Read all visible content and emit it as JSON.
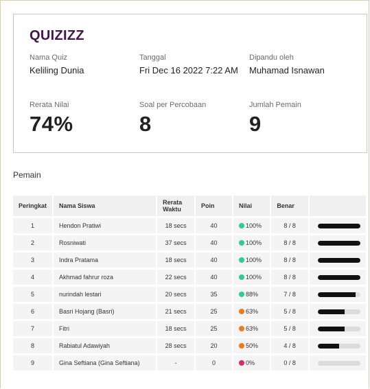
{
  "brand": {
    "logo_text": "QUIZIZZ",
    "logo_color": "#46134f"
  },
  "summary": {
    "quiz_name_label": "Nama Quiz",
    "quiz_name": "Keliling Dunia",
    "date_label": "Tanggal",
    "date": "Fri Dec 16 2022 7:22 AM",
    "host_label": "Dipandu oleh",
    "host": "Muhamad Isnawan",
    "avg_score_label": "Rerata Nilai",
    "avg_score": "74%",
    "questions_label": "Soal per Percobaan",
    "questions": "8",
    "players_label": "Jumlah Pemain",
    "players": "9"
  },
  "players_section": {
    "title": "Pemain",
    "headers": {
      "rank": "Peringkat",
      "name": "Nama Siswa",
      "avg_time": "Rerata Waktu",
      "points": "Poin",
      "score": "Nilai",
      "correct": "Benar"
    },
    "rows": [
      {
        "rank": "1",
        "name": "Hendon Pratiwi",
        "avg_time": "18 secs",
        "points": "40",
        "score": "100%",
        "score_pct": 100,
        "color": "#2ecc8f",
        "correct": "8 / 8"
      },
      {
        "rank": "2",
        "name": "Rosniwati",
        "avg_time": "37 secs",
        "points": "40",
        "score": "100%",
        "score_pct": 100,
        "color": "#2ecc8f",
        "correct": "8 / 8"
      },
      {
        "rank": "3",
        "name": "Indra Pratama",
        "avg_time": "18 secs",
        "points": "40",
        "score": "100%",
        "score_pct": 100,
        "color": "#2ecc8f",
        "correct": "8 / 8"
      },
      {
        "rank": "4",
        "name": "Akhmad fahrur roza",
        "avg_time": "22 secs",
        "points": "40",
        "score": "100%",
        "score_pct": 100,
        "color": "#2ecc8f",
        "correct": "8 / 8"
      },
      {
        "rank": "5",
        "name": "nurindah lestari",
        "avg_time": "20 secs",
        "points": "35",
        "score": "88%",
        "score_pct": 88,
        "color": "#2ecc8f",
        "correct": "7 / 8"
      },
      {
        "rank": "6",
        "name": "Basri Hojang (Basri)",
        "avg_time": "21 secs",
        "points": "25",
        "score": "63%",
        "score_pct": 63,
        "color": "#f07a1a",
        "correct": "5 / 8"
      },
      {
        "rank": "7",
        "name": "Fitri",
        "avg_time": "18 secs",
        "points": "25",
        "score": "63%",
        "score_pct": 63,
        "color": "#f07a1a",
        "correct": "5 / 8"
      },
      {
        "rank": "8",
        "name": "Rabiatul Adawiyah",
        "avg_time": "28 secs",
        "points": "20",
        "score": "50%",
        "score_pct": 50,
        "color": "#f07a1a",
        "correct": "4 / 8"
      },
      {
        "rank": "9",
        "name": "Gina Seftiana (Gina Seftiana)",
        "avg_time": "-",
        "points": "0",
        "score": "0%",
        "score_pct": 0,
        "color": "#e0266e",
        "correct": "0 / 8"
      }
    ]
  }
}
